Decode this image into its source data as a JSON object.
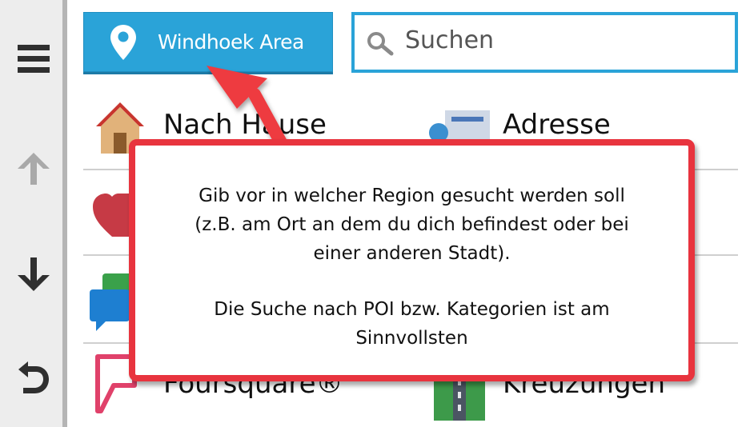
{
  "header": {
    "region_label": "Windhoek Area",
    "search_placeholder": "Suchen"
  },
  "menu": {
    "items": [
      {
        "label": "Nach Hause",
        "icon": "house-icon"
      },
      {
        "label": "Adresse",
        "icon": "address-card-icon"
      },
      {
        "label": "Foursquare®",
        "icon": "foursquare-icon"
      },
      {
        "label": "Kreuzungen",
        "icon": "intersection-icon"
      }
    ]
  },
  "callout": {
    "lines": [
      "Gib vor in welcher Region gesucht werden soll",
      "(z.B. am Ort an dem du dich befindest oder bei",
      "einer anderen Stadt).",
      "Die Suche nach POI bzw. Kategorien ist am",
      "Sinnvollsten"
    ]
  },
  "colors": {
    "accent": "#2aa3d8",
    "callout_border": "#e8343e",
    "arrow": "#ee3b40",
    "rail_bg": "#ededed"
  },
  "rail": {
    "icons": [
      "hamburger-menu-icon",
      "arrow-up-icon",
      "arrow-down-icon",
      "back-icon"
    ]
  }
}
